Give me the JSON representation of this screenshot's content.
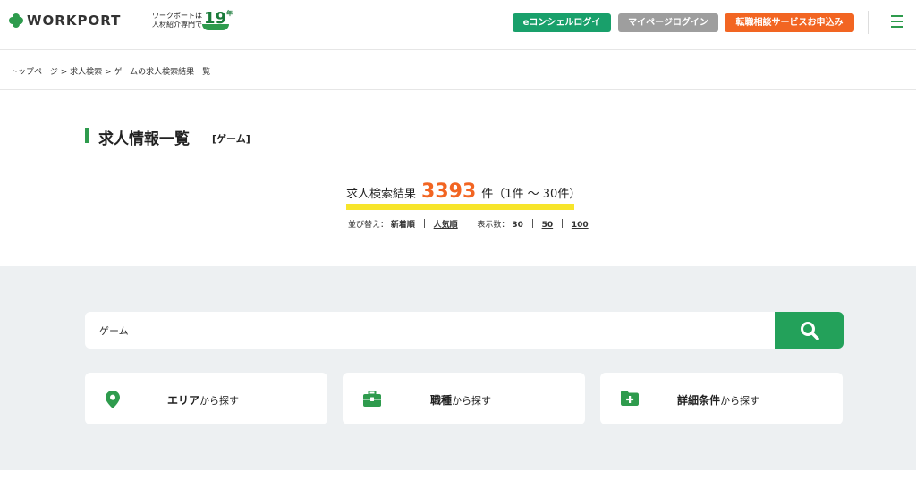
{
  "header": {
    "brand": "WORKPORT",
    "tagline_line1": "ワークポートは",
    "tagline_line2": "人材紹介専門で",
    "years_number": "19",
    "years_unit": "年",
    "econ_login": "eコンシェルログイン",
    "mypage_login": "マイページログイン",
    "apply": "転職相談サービスお申込み"
  },
  "breadcrumb": {
    "top": "トップページ",
    "search": "求人検索",
    "current": "ゲームの求人検索結果一覧"
  },
  "page": {
    "title": "求人情報一覧",
    "category": "[ゲーム]"
  },
  "results": {
    "label": "求人検索結果",
    "count": "3393",
    "unit_range": "件（1件 ～ 30件）"
  },
  "sort": {
    "label": "並び替え：",
    "newest": "新着順",
    "popular": "人気順",
    "display_label": "表示数：",
    "display_30": "30",
    "display_50": "50",
    "display_100": "100"
  },
  "search": {
    "value": "ゲーム"
  },
  "cards": {
    "area_bold": "エリア",
    "area_rest": "から探す",
    "job_bold": "職種",
    "job_rest": "から探す",
    "detail_bold": "詳細条件",
    "detail_rest": "から探す"
  },
  "colors": {
    "brand_green": "#2e9b4d",
    "econ_green": "#19a06b",
    "mypage_gray": "#9e9e9e",
    "apply_orange": "#f26522",
    "count_orange": "#f26522",
    "highlight_yellow": "#f7e52a",
    "panel_bg": "#edf0f2"
  }
}
